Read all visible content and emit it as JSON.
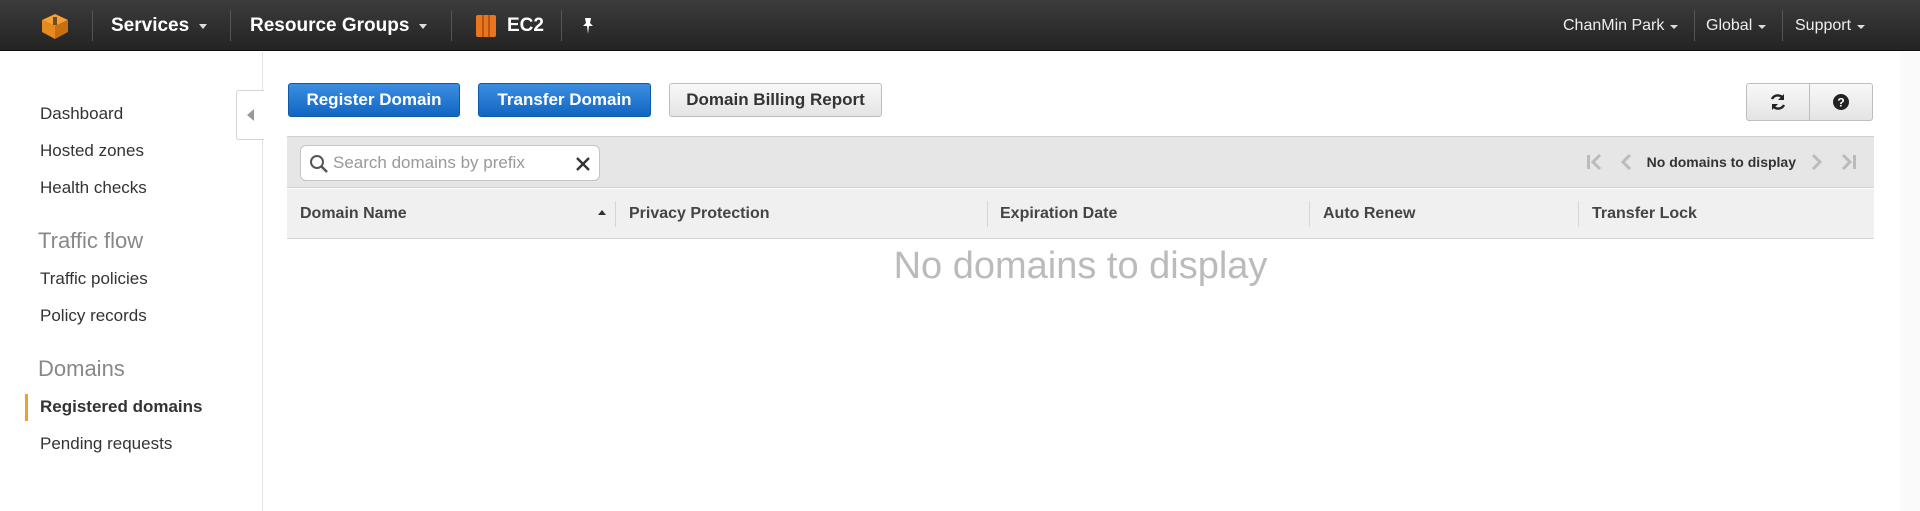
{
  "colors": {
    "nav_bg": "#2b2b2b",
    "primary": "#1a73d0",
    "accent_orange": "#f0a030"
  },
  "topnav": {
    "services": "Services",
    "resource_groups": "Resource Groups",
    "ec2": "EC2",
    "user": "ChanMin Park",
    "region": "Global",
    "support": "Support"
  },
  "sidebar": {
    "items": [
      {
        "label": "Dashboard"
      },
      {
        "label": "Hosted zones"
      },
      {
        "label": "Health checks"
      }
    ],
    "traffic_flow": {
      "heading": "Traffic flow",
      "items": [
        {
          "label": "Traffic policies"
        },
        {
          "label": "Policy records"
        }
      ]
    },
    "domains": {
      "heading": "Domains",
      "items": [
        {
          "label": "Registered domains",
          "active": true
        },
        {
          "label": "Pending requests"
        }
      ]
    }
  },
  "actions": {
    "register": "Register Domain",
    "transfer": "Transfer Domain",
    "billing": "Domain Billing Report"
  },
  "search": {
    "placeholder": "Search domains by prefix",
    "value": ""
  },
  "pager": {
    "text": "No domains to display"
  },
  "table": {
    "columns": [
      "Domain Name",
      "Privacy Protection",
      "Expiration Date",
      "Auto Renew",
      "Transfer Lock"
    ],
    "rows": [],
    "empty_text": "No domains to display"
  }
}
